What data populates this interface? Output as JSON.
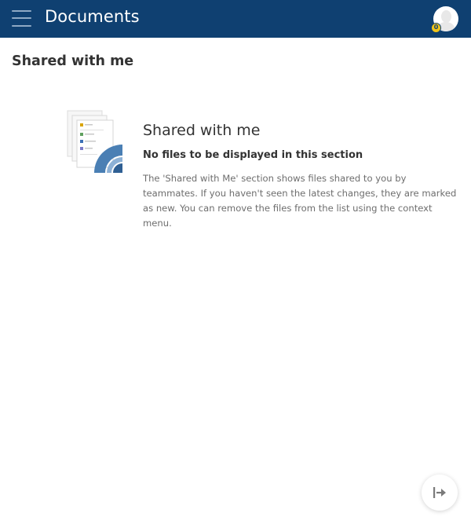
{
  "header": {
    "title": "Documents",
    "menu_icon": "hamburger-menu-icon",
    "avatar_icon": "user-avatar-icon",
    "badge_count": "0",
    "colors": {
      "bar": "#0f4071",
      "badge": "#f0c419"
    }
  },
  "page": {
    "title": "Shared with me"
  },
  "empty_state": {
    "illustration_icon": "shared-documents-illustration-icon",
    "header": "Shared with me",
    "subheader": "No files to be displayed in this section",
    "description": "The 'Shared with Me' section shows files shared to you by teammates. If you haven't seen the latest changes, they are marked as new. You can remove the files from the list using the context menu."
  },
  "floating_action": {
    "icon": "logout-arrow-icon"
  }
}
